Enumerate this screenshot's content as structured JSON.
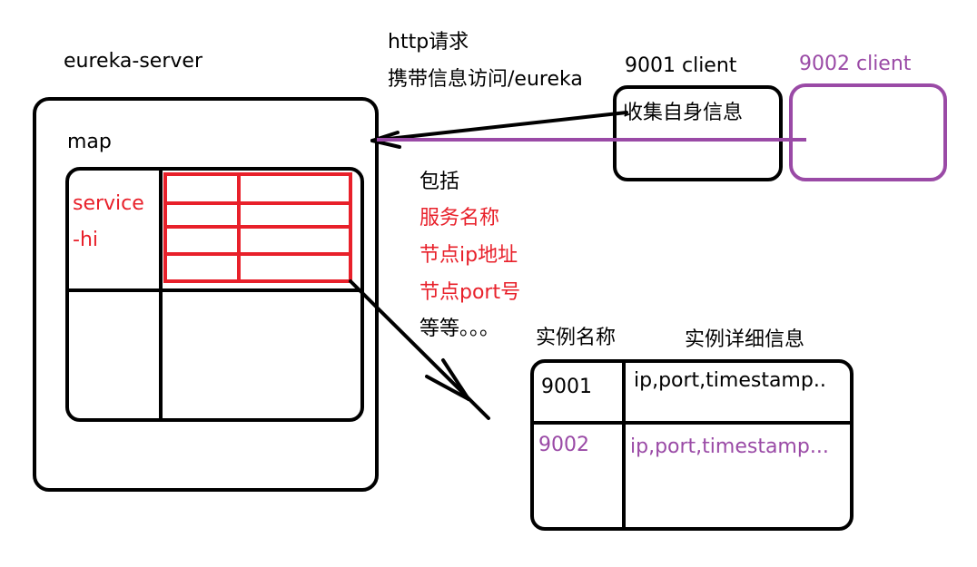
{
  "colors": {
    "ink": "#000000",
    "red": "#e8202a",
    "purple": "#9a4aa6"
  },
  "server": {
    "title": "eureka-server",
    "map_label": "map",
    "service_label_line1": "service",
    "service_label_line2": "-hi"
  },
  "request": {
    "line1": "http请求",
    "line2": "携带信息访问/eureka"
  },
  "client_9001": {
    "title": "9001 client",
    "body": "收集自身信息"
  },
  "client_9002": {
    "title": "9002 client"
  },
  "includes": {
    "heading": "包括",
    "items": [
      "服务名称",
      "节点ip地址",
      "节点port号"
    ],
    "etc": "等等。。。"
  },
  "instance_table": {
    "header_name": "实例名称",
    "header_detail": "实例详细信息",
    "rows": [
      {
        "name": "9001",
        "detail": "ip,port,timestamp.."
      },
      {
        "name": "9002",
        "detail": "ip,port,timestamp..."
      }
    ]
  }
}
